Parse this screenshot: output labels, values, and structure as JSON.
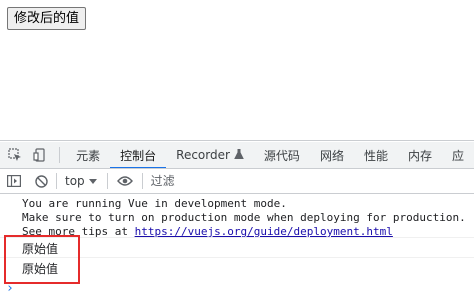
{
  "page": {
    "button_label": "修改后的值"
  },
  "devtools": {
    "tabs": [
      {
        "label": "元素"
      },
      {
        "label": "控制台"
      },
      {
        "label": "Recorder"
      },
      {
        "label": "源代码"
      },
      {
        "label": "网络"
      },
      {
        "label": "性能"
      },
      {
        "label": "内存"
      },
      {
        "label": "应"
      }
    ],
    "toolbar": {
      "context": "top",
      "filter_placeholder": "过滤"
    },
    "console": {
      "vue_line1": "You are running Vue in development mode.",
      "vue_line2": "Make sure to turn on production mode when deploying for production.",
      "vue_line3_prefix": "See more tips at ",
      "vue_link": "https://vuejs.org/guide/deployment.html",
      "logs": [
        "原始值",
        "原始值"
      ],
      "prompt": "›"
    }
  },
  "colors": {
    "accent": "#1a73e8",
    "highlight": "#e52b2b"
  }
}
